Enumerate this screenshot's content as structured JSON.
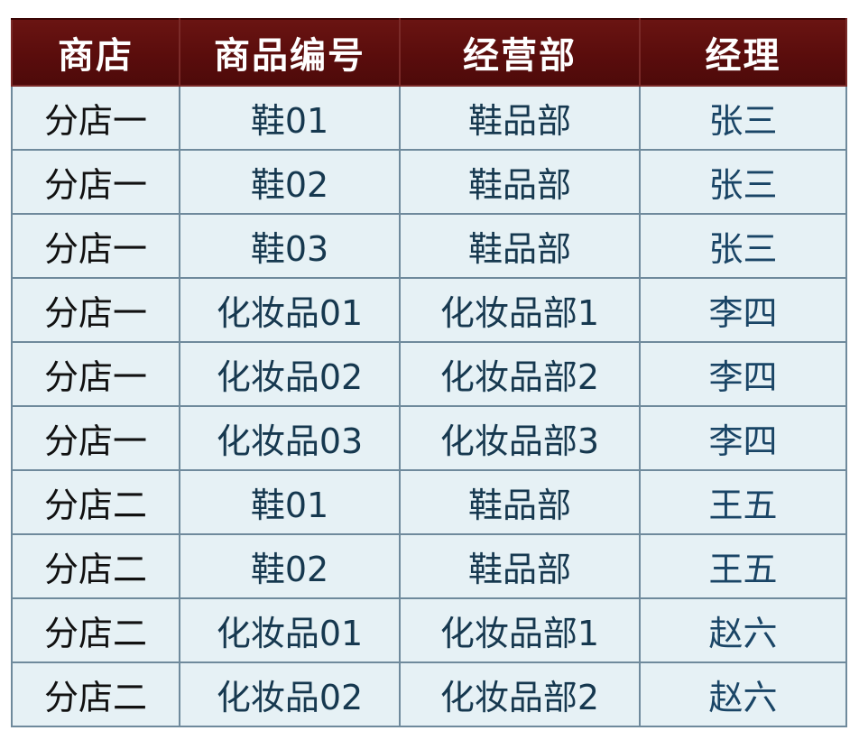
{
  "table": {
    "headers": [
      "商店",
      "商品编号",
      "经营部",
      "经理"
    ],
    "rows": [
      [
        "分店一",
        "鞋01",
        "鞋品部",
        "张三"
      ],
      [
        "分店一",
        "鞋02",
        "鞋品部",
        "张三"
      ],
      [
        "分店一",
        "鞋03",
        "鞋品部",
        "张三"
      ],
      [
        "分店一",
        "化妆品01",
        "化妆品部1",
        "李四"
      ],
      [
        "分店一",
        "化妆品02",
        "化妆品部2",
        "李四"
      ],
      [
        "分店一",
        "化妆品03",
        "化妆品部3",
        "李四"
      ],
      [
        "分店二",
        "鞋01",
        "鞋品部",
        "王五"
      ],
      [
        "分店二",
        "鞋02",
        "鞋品部",
        "王五"
      ],
      [
        "分店二",
        "化妆品01",
        "化妆品部1",
        "赵六"
      ],
      [
        "分店二",
        "化妆品02",
        "化妆品部2",
        "赵六"
      ]
    ]
  },
  "colors": {
    "header_background": "#5a0d0c",
    "header_text": "#ffffff",
    "cell_background": "#e6f1f5",
    "cell_border": "#6f8a9c",
    "cell_text": "#16384f"
  }
}
